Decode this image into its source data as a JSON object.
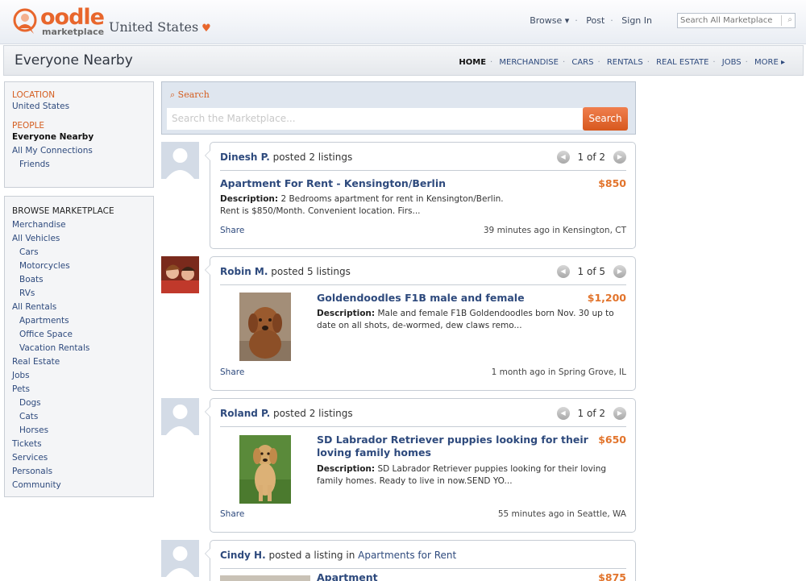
{
  "header": {
    "logo_word": "oodle",
    "logo_sub": "marketplace",
    "country": "United States",
    "nav": [
      "Browse ▾",
      "Post",
      "Sign In"
    ],
    "search_placeholder": "Search All Marketplace"
  },
  "subheader": {
    "title": "Everyone Nearby",
    "nav": [
      "HOME",
      "MERCHANDISE",
      "CARS",
      "RENTALS",
      "REAL ESTATE",
      "JOBS",
      "MORE ▸"
    ],
    "active": "HOME"
  },
  "sidebar": {
    "location_head": "LOCATION",
    "location_value": "United States",
    "people_head": "PEOPLE",
    "people_items": [
      "Everyone Nearby",
      "All My Connections",
      "Friends"
    ],
    "browse_head": "BROWSE MARKETPLACE",
    "browse_items": [
      {
        "label": "Merchandise",
        "indent": false
      },
      {
        "label": "All Vehicles",
        "indent": false
      },
      {
        "label": "Cars",
        "indent": true
      },
      {
        "label": "Motorcycles",
        "indent": true
      },
      {
        "label": "Boats",
        "indent": true
      },
      {
        "label": "RVs",
        "indent": true
      },
      {
        "label": "All Rentals",
        "indent": false
      },
      {
        "label": "Apartments",
        "indent": true
      },
      {
        "label": "Office Space",
        "indent": true
      },
      {
        "label": "Vacation Rentals",
        "indent": true
      },
      {
        "label": "Real Estate",
        "indent": false
      },
      {
        "label": "Jobs",
        "indent": false
      },
      {
        "label": "Pets",
        "indent": false
      },
      {
        "label": "Dogs",
        "indent": true
      },
      {
        "label": "Cats",
        "indent": true
      },
      {
        "label": "Horses",
        "indent": true
      },
      {
        "label": "Tickets",
        "indent": false
      },
      {
        "label": "Services",
        "indent": false
      },
      {
        "label": "Personals",
        "indent": false
      },
      {
        "label": "Community",
        "indent": false
      }
    ]
  },
  "search": {
    "label": "Search",
    "placeholder": "Search the Marketplace...",
    "button": "Search"
  },
  "feed": [
    {
      "user": "Dinesh P.",
      "action": " posted 2 listings",
      "pager": "1 of 2",
      "title": "Apartment For Rent - Kensington/Berlin",
      "price": "$850",
      "desc_label": "Description:",
      "desc": " 2 Bedrooms apartment for rent in Kensington/Berlin. Rent is $850/Month. Convenient location. Firs...",
      "share": "Share",
      "meta": "39 minutes ago in Kensington, CT"
    },
    {
      "user": "Robin M.",
      "action": " posted 5 listings",
      "pager": "1 of 5",
      "title": "Goldendoodles F1B male and female",
      "price": "$1,200",
      "desc_label": "Description:",
      "desc": " Male and female F1B Goldendoodles born Nov. 30 up to date on all shots, de-wormed, dew claws remo...",
      "share": "Share",
      "meta": "1 month ago in Spring Grove, IL"
    },
    {
      "user": "Roland P.",
      "action": " posted 2 listings",
      "pager": "1 of 2",
      "title": "SD Labrador Retriever puppies looking for their loving family homes",
      "price": "$650",
      "desc_label": "Description:",
      "desc": " SD Labrador Retriever puppies looking for their loving family homes. Ready to live in now.SEND YO...",
      "share": "Share",
      "meta": "55 minutes ago in Seattle, WA"
    },
    {
      "user": "Cindy H.",
      "action": " posted a listing in ",
      "category": "Apartments for Rent",
      "title": "Apartment",
      "price": "$875"
    }
  ],
  "colors": {
    "brand_orange": "#e8662c",
    "link_blue": "#2e4a7d",
    "price_orange": "#e2742c"
  }
}
